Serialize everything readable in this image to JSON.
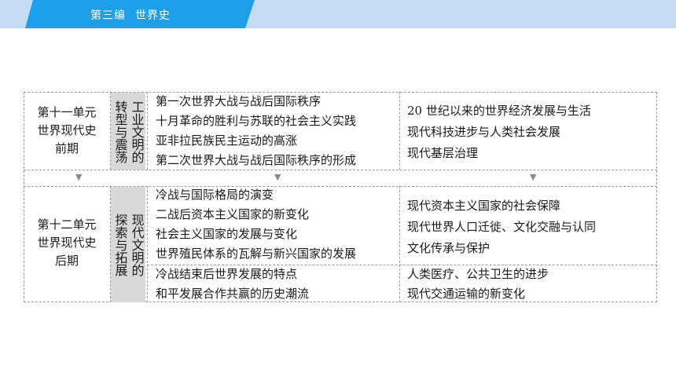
{
  "header": {
    "section": "第三编",
    "title": "世界史"
  },
  "rows": [
    {
      "unit_lines": [
        "第十一单元",
        "世界现代史",
        "前期"
      ],
      "theme_columns": [
        "工业文明的",
        "转型与震荡"
      ],
      "events_block_1": [
        "第一次世界大战与战后国际秩序",
        "十月革命的胜利与苏联的社会主义实践",
        "亚非拉民族民主运动的高涨",
        "第二次世界大战与战后国际秩序的形成"
      ],
      "topics_block_1": [
        "20 世纪以来的世界经济发展与生活",
        "现代科技进步与人类社会发展",
        "现代基层治理"
      ]
    },
    {
      "unit_lines": [
        "第十二单元",
        "世界现代史",
        "后期"
      ],
      "theme_columns": [
        "现代文明的",
        "探索与拓展"
      ],
      "events_block_1": [
        "冷战与国际格局的演变",
        "二战后资本主义国家的新变化",
        "社会主义国家的发展与变化",
        "世界殖民体系的瓦解与新兴国家的发展"
      ],
      "topics_block_1": [
        "现代资本主义国家的社会保障",
        "现代世界人口迁徙、文化交融与认同",
        "文化传承与保护"
      ],
      "events_block_2": [
        "冷战结束后世界发展的特点",
        "和平发展合作共赢的历史潮流"
      ],
      "topics_block_2": [
        "人类医疗、公共卫生的进步",
        "现代交通运输的新变化"
      ]
    }
  ],
  "arrow_glyph": "▼"
}
